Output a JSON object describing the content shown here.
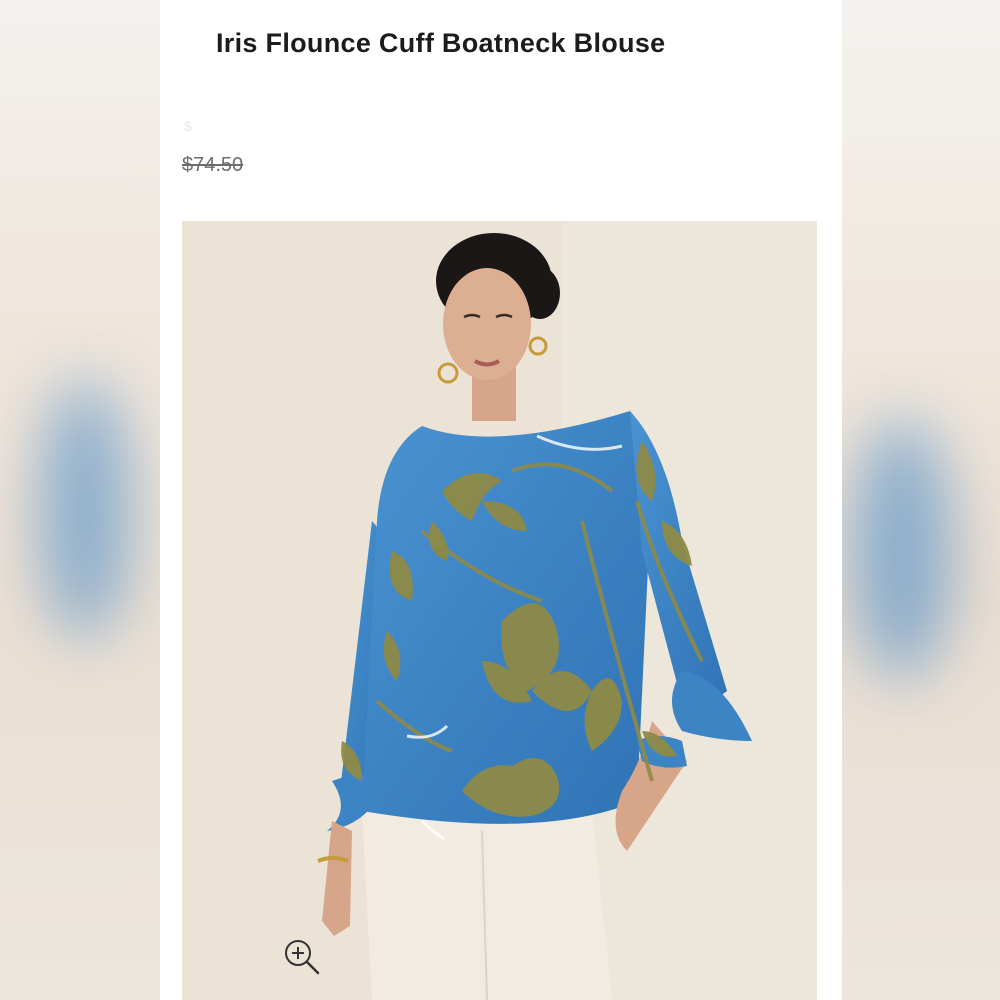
{
  "product": {
    "title": "Iris Flounce Cuff Boatneck Blouse",
    "sale_price": "$",
    "original_price": "$74.50"
  },
  "image": {
    "alt": "Model wearing blue floral Iris Flounce Cuff Boatneck Blouse with white pants"
  },
  "icons": {
    "zoom": "zoom-in-icon"
  },
  "colors": {
    "blouse_blue": "#3d84c4",
    "print_olive": "#8e8a47",
    "background": "#ffffff",
    "title_text": "#1c1c1c",
    "strikethrough_price": "#6d6d6d"
  }
}
